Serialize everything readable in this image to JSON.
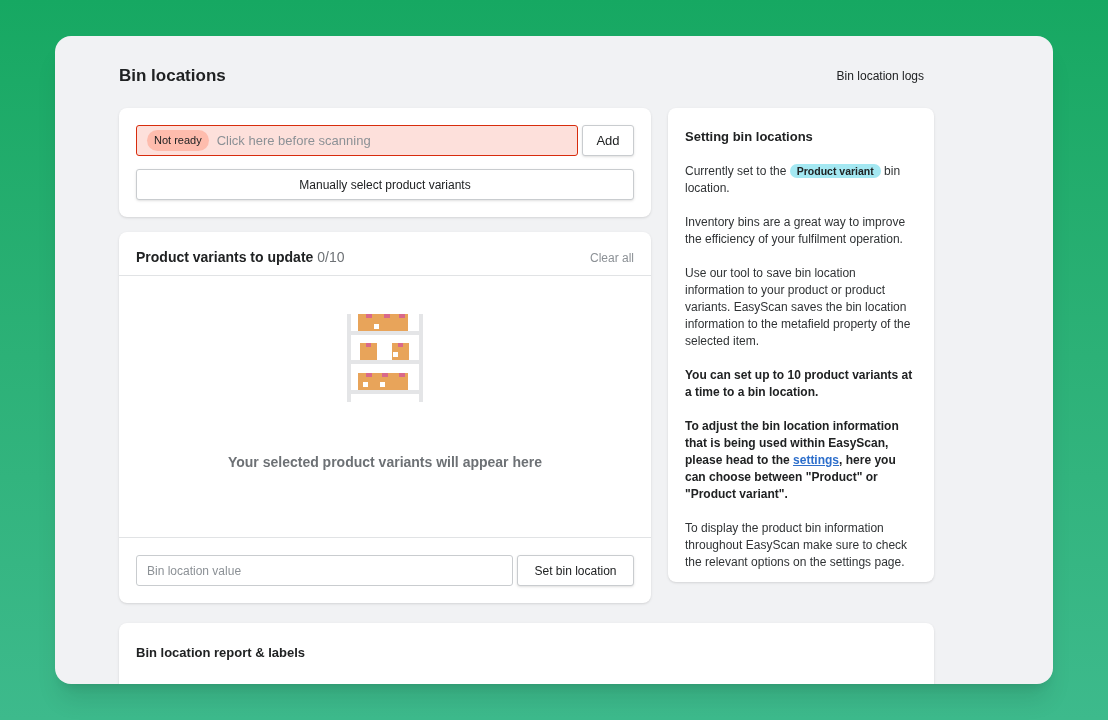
{
  "page": {
    "title": "Bin locations",
    "header_link": "Bin location logs"
  },
  "scan_card": {
    "status_badge": "Not ready",
    "ready": false,
    "placeholder": "Click here before scanning",
    "add_button": "Add",
    "manual_button": "Manually select product variants"
  },
  "variants_card": {
    "title": "Product variants to update",
    "count": "0/10",
    "clear_all": "Clear all",
    "empty_message": "Your selected product variants will appear here",
    "bin_field_placeholder": "Bin location value",
    "set_button": "Set bin location"
  },
  "info_panel": {
    "title": "Setting bin locations",
    "paragraphs": [
      {
        "kind": "badge",
        "before": "Currently set to the ",
        "badge": "Product variant",
        "after": " bin location."
      },
      {
        "kind": "plain",
        "text": "Inventory bins are a great way to improve the efficiency of your fulfilment operation."
      },
      {
        "kind": "plain",
        "text": "Use our tool to save bin location information to your product or product variants. EasyScan saves the bin location information to the metafield property of the selected item."
      },
      {
        "kind": "bold",
        "text": "You can set up to 10 product variants at a time to a bin location."
      },
      {
        "kind": "link",
        "before": "To adjust the bin location information that is being used within EasyScan, please head to the ",
        "link": "settings",
        "after": ", here you can choose between \"Product\" or \"Product variant\"."
      },
      {
        "kind": "plain",
        "text": "To display the product bin information throughout EasyScan make sure to check the relevant options on the settings page."
      }
    ]
  },
  "report_card": {
    "title": "Bin location report & labels"
  }
}
